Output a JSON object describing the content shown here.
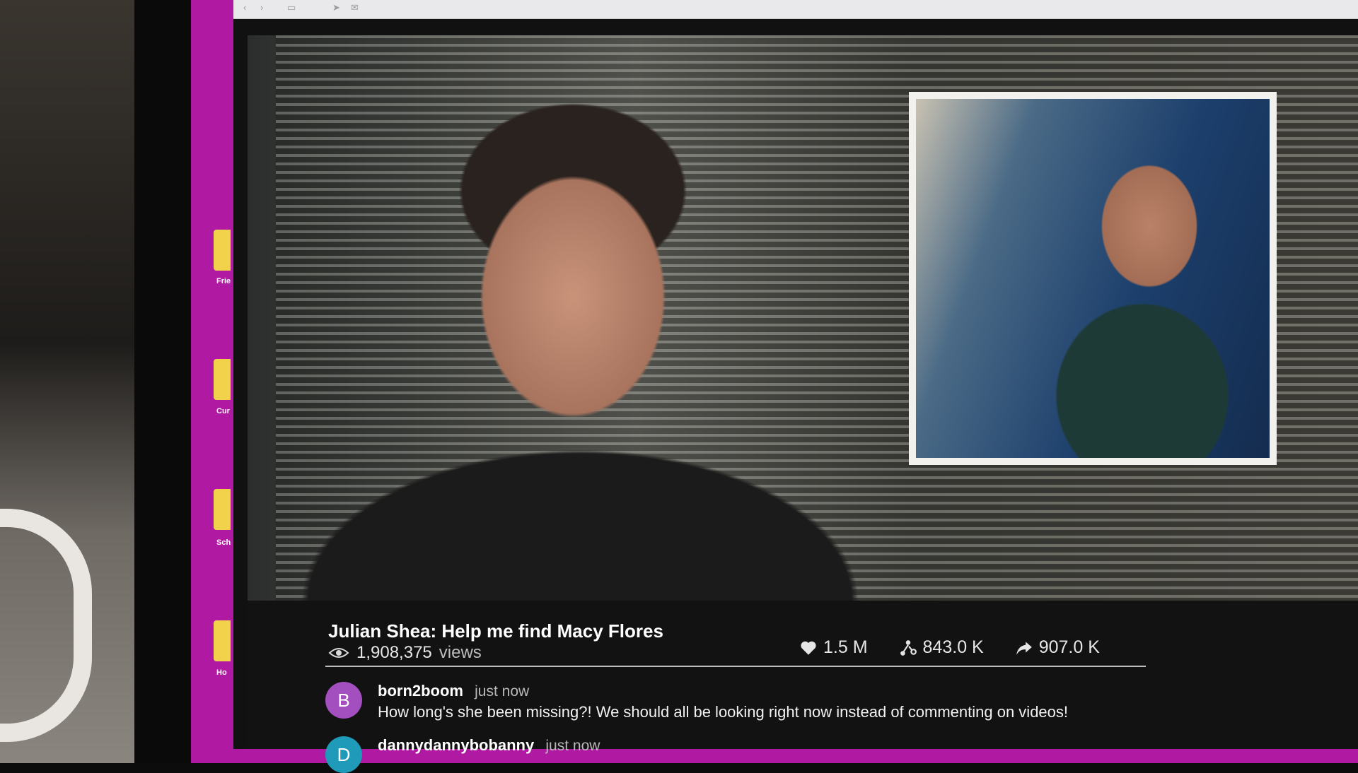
{
  "desktop": {
    "icons": [
      {
        "label": "Frie"
      },
      {
        "label": "Cur"
      },
      {
        "label": "Sch"
      },
      {
        "label": "Ho"
      }
    ]
  },
  "video": {
    "title": "Julian Shea: Help me find Macy Flores",
    "views_count": "1,908,375",
    "views_label": "views",
    "likes": "1.5 M",
    "shares_network": "843.0 K",
    "shares": "907.0 K"
  },
  "comments": [
    {
      "avatar_letter": "B",
      "avatar_color": "#a44fbf",
      "user": "born2boom",
      "time": "just now",
      "text": "How long's she been missing?! We should all be looking right now instead of commenting on videos!"
    },
    {
      "avatar_letter": "D",
      "avatar_color": "#1f9ab8",
      "user": "dannydannybobanny",
      "time": "just now",
      "text": ""
    }
  ],
  "colors": {
    "desktop_bg": "#b01aa3",
    "accent_icon": "#f3d24b"
  }
}
